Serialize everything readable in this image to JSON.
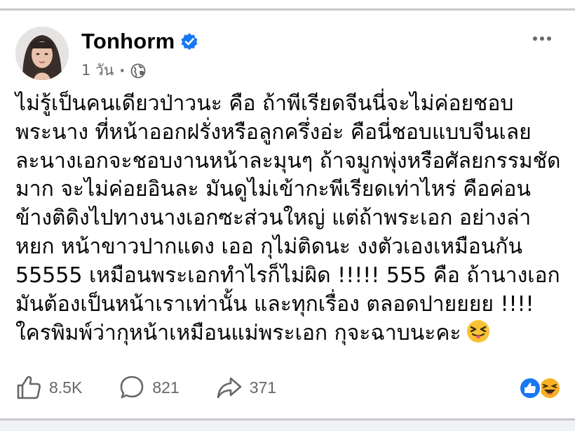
{
  "post": {
    "author": "Tonhorm",
    "verified": true,
    "time": "1 วัน",
    "privacy_icon": "globe-icon",
    "lines": [
      "ไม่รู้เป็นคนเดียวป่าวนะ คือ ถ้าพีเรียดจีนนี่จะไม่ค่อยชอบ",
      "พระนาง ที่หน้าออกฝรั่งหรือลูกครึ่งอ่ะ คือนี่ชอบแบบจีนเลย",
      "ละนางเอกจะชอบงานหน้าละมุนๆ ถ้าจมูกพุ่งหรือศัลยกรรมชัด",
      "มาก จะไม่ค่อยอินละ มันดูไม่เข้ากะพีเรียดเท่าไหร่ คือค่อน",
      "ข้างติดิงไปทางนางเอกซะส่วนใหญ่ แต่ถ้าพระเอก อย่างล่า",
      "หยก หน้าขาวปากแดง เออ กุไม่ติดนะ งงตัวเองเหมือนกัน",
      "55555 เหมือนพระเอกทำไรก็ไม่ผิด !!!!! 555 คือ ถ้านางเอก",
      "มันต้องเป็นหน้าเราเท่านั้น และทุกเรื่อง ตลอดปายยยย !!!!",
      "ใครพิมพ์ว่ากุหน้าเหมือนแม่พระเอก กุจะฉาบนะคะ"
    ],
    "trailing_emoji": "squinting-tongue-emoji"
  },
  "stats": {
    "likes": "8.5K",
    "comments": "821",
    "shares": "371"
  },
  "colors": {
    "verified_blue": "#1877f2",
    "meta_grey": "#65676b",
    "like_blue": "#1877f2",
    "haha_yellow": "#f7b125"
  }
}
